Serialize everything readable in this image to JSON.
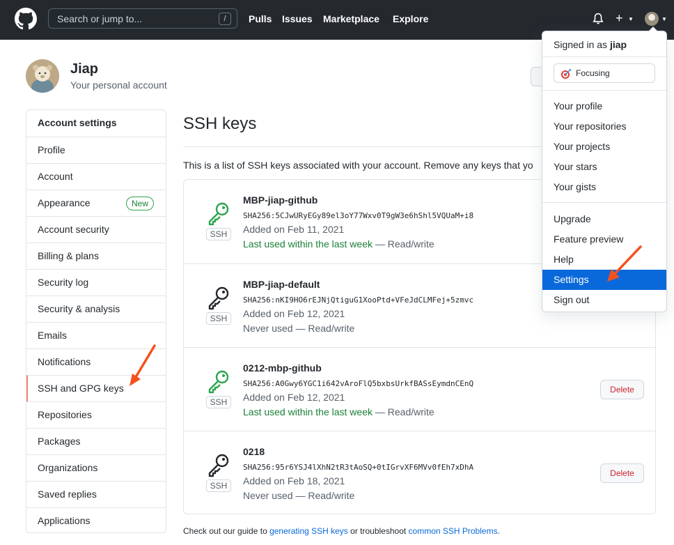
{
  "header": {
    "search_placeholder": "Search or jump to...",
    "search_shortcut": "/",
    "nav": [
      "Pulls",
      "Issues",
      "Marketplace",
      "Explore"
    ],
    "plus_label": "+"
  },
  "profile": {
    "name": "Jiap",
    "subtitle": "Your personal account"
  },
  "sidebar": {
    "heading": "Account settings",
    "items": [
      "Profile",
      "Account",
      "Appearance",
      "Account security",
      "Billing & plans",
      "Security log",
      "Security & analysis",
      "Emails",
      "Notifications",
      "SSH and GPG keys",
      "Repositories",
      "Packages",
      "Organizations",
      "Saved replies",
      "Applications"
    ],
    "new_badge": "New",
    "selected": "SSH and GPG keys"
  },
  "main": {
    "title": "SSH keys",
    "description": "This is a list of SSH keys associated with your account. Remove any keys that yo",
    "ssh_label": "SSH",
    "delete_label": "Delete",
    "keys": [
      {
        "title": "MBP-jiap-github",
        "fingerprint": "SHA256:5CJwURyEGy89el3oY77Wxv0T9gW3e6hShl5VQUaM+i8",
        "added": "Added on Feb 11, 2021",
        "last_used": "Last used within the last week",
        "access": " — Read/write",
        "recent": true
      },
      {
        "title": "MBP-jiap-default",
        "fingerprint": "SHA256:nKI9HO6rEJNjQtiguG1XooPtd+VFeJdCLMFej+5zmvc",
        "added": "Added on Feb 12, 2021",
        "last_used": "Never used",
        "access": " — Read/write",
        "recent": false
      },
      {
        "title": "0212-mbp-github",
        "fingerprint": "SHA256:A0Gwy6YGC1i642vAroFlQ5bxbsUrkfBASsEymdnCEnQ",
        "added": "Added on Feb 12, 2021",
        "last_used": "Last used within the last week",
        "access": " — Read/write",
        "recent": true
      },
      {
        "title": "0218",
        "fingerprint": "SHA256:95r6YSJ4lXhN2tR3tAoSQ+0tIGrvXF6MVv0fEh7xDhA",
        "added": "Added on Feb 18, 2021",
        "last_used": "Never used",
        "access": " — Read/write",
        "recent": false
      }
    ],
    "footer": {
      "prefix": "Check out our guide to ",
      "link1": "generating SSH keys",
      "middle": " or troubleshoot ",
      "link2": "common SSH Problems",
      "suffix": "."
    }
  },
  "dropdown": {
    "signed_in_prefix": "Signed in as ",
    "username": "jiap",
    "status": "Focusing",
    "group1": [
      "Your profile",
      "Your repositories",
      "Your projects",
      "Your stars",
      "Your gists"
    ],
    "group2": [
      "Upgrade",
      "Feature preview",
      "Help",
      "Settings",
      "Sign out"
    ],
    "active": "Settings"
  },
  "colors": {
    "header_bg": "#24292e",
    "accent_blue": "#0969da",
    "success_green": "#1a7f37",
    "danger_red": "#cf222e",
    "selected_orange": "#f9826c",
    "annotation_arrow": "#f4511e"
  }
}
